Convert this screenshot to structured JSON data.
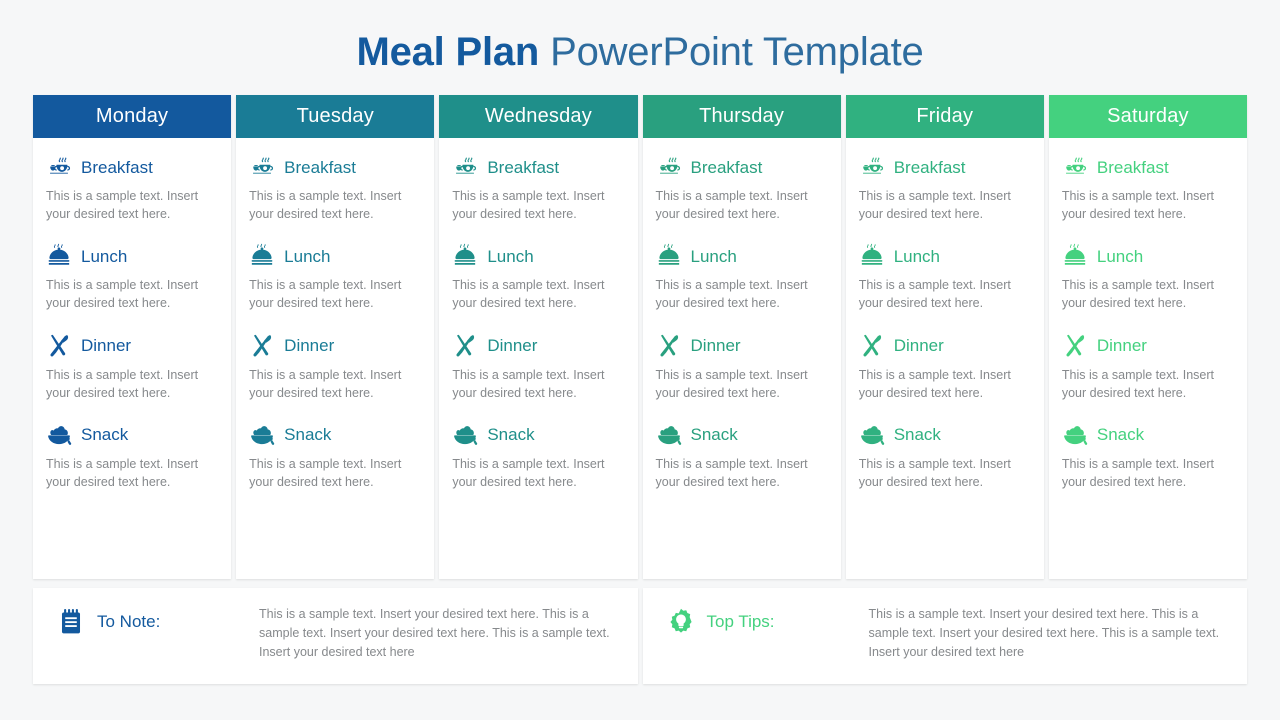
{
  "title": {
    "strong": "Meal Plan",
    "light": " PowerPoint Template",
    "strong_color": "#145a9e",
    "light_color": "#2e6c9e"
  },
  "meal_labels": {
    "breakfast": "Breakfast",
    "lunch": "Lunch",
    "dinner": "Dinner",
    "snack": "Snack"
  },
  "sample_text": "This is a sample text. Insert your desired text here.",
  "days": [
    {
      "name": "Monday",
      "color": "#13599e",
      "meals": [
        {
          "icon": "teapot-icon",
          "label": "Breakfast",
          "desc": "This is a sample text. Insert your desired text here."
        },
        {
          "icon": "cloche-icon",
          "label": "Lunch",
          "desc": "This is a sample text. Insert your desired text here."
        },
        {
          "icon": "fork-knife-icon",
          "label": "Dinner",
          "desc": "This is a sample text. Insert your desired text here."
        },
        {
          "icon": "snack-bowl-icon",
          "label": "Snack",
          "desc": "This is a sample text. Insert your desired text here."
        }
      ]
    },
    {
      "name": "Tuesday",
      "color": "#1a7c96",
      "meals": [
        {
          "icon": "teapot-icon",
          "label": "Breakfast",
          "desc": "This is a sample text. Insert your desired text here."
        },
        {
          "icon": "cloche-icon",
          "label": "Lunch",
          "desc": "This is a sample text. Insert your desired text here."
        },
        {
          "icon": "fork-knife-icon",
          "label": "Dinner",
          "desc": "This is a sample text. Insert your desired text here."
        },
        {
          "icon": "snack-bowl-icon",
          "label": "Snack",
          "desc": "This is a sample text. Insert your desired text here."
        }
      ]
    },
    {
      "name": "Wednesday",
      "color": "#1f8f8a",
      "meals": [
        {
          "icon": "teapot-icon",
          "label": "Breakfast",
          "desc": "This is a sample text. Insert your desired text here."
        },
        {
          "icon": "cloche-icon",
          "label": "Lunch",
          "desc": "This is a sample text. Insert your desired text here."
        },
        {
          "icon": "fork-knife-icon",
          "label": "Dinner",
          "desc": "This is a sample text. Insert your desired text here."
        },
        {
          "icon": "snack-bowl-icon",
          "label": "Snack",
          "desc": "This is a sample text. Insert your desired text here."
        }
      ]
    },
    {
      "name": "Thursday",
      "color": "#29a07f",
      "meals": [
        {
          "icon": "teapot-icon",
          "label": "Breakfast",
          "desc": "This is a sample text. Insert your desired text here."
        },
        {
          "icon": "cloche-icon",
          "label": "Lunch",
          "desc": "This is a sample text. Insert your desired text here."
        },
        {
          "icon": "fork-knife-icon",
          "label": "Dinner",
          "desc": "This is a sample text. Insert your desired text here."
        },
        {
          "icon": "snack-bowl-icon",
          "label": "Snack",
          "desc": "This is a sample text. Insert your desired text here."
        }
      ]
    },
    {
      "name": "Friday",
      "color": "#30b180",
      "meals": [
        {
          "icon": "teapot-icon",
          "label": "Breakfast",
          "desc": "This is a sample text. Insert your desired text here."
        },
        {
          "icon": "cloche-icon",
          "label": "Lunch",
          "desc": "This is a sample text. Insert your desired text here."
        },
        {
          "icon": "fork-knife-icon",
          "label": "Dinner",
          "desc": "This is a sample text. Insert your desired text here."
        },
        {
          "icon": "snack-bowl-icon",
          "label": "Snack",
          "desc": "This is a sample text. Insert your desired text here."
        }
      ]
    },
    {
      "name": "Saturday",
      "color": "#44d17f",
      "meals": [
        {
          "icon": "teapot-icon",
          "label": "Breakfast",
          "desc": "This is a sample text. Insert your desired text here."
        },
        {
          "icon": "cloche-icon",
          "label": "Lunch",
          "desc": "This is a sample text. Insert your desired text here."
        },
        {
          "icon": "fork-knife-icon",
          "label": "Dinner",
          "desc": "This is a sample text. Insert your desired text here."
        },
        {
          "icon": "snack-bowl-icon",
          "label": "Snack",
          "desc": "This is a sample text. Insert your desired text here."
        }
      ]
    }
  ],
  "footer": [
    {
      "icon": "notepad-icon",
      "label": "To Note:",
      "color": "#13599e",
      "text": "This is a sample text. Insert your desired text here. This is a sample text. Insert your desired text here. This is a sample text. Insert your desired text here"
    },
    {
      "icon": "lightbulb-icon",
      "label": "Top Tips:",
      "color": "#44d17f",
      "text": "This is a sample text. Insert your desired text here. This is a sample text. Insert your desired text here. This is a sample text. Insert your desired text here"
    }
  ]
}
